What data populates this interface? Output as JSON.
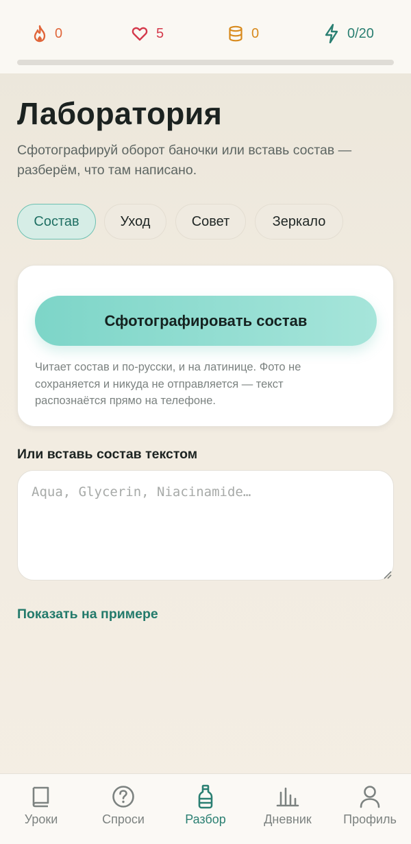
{
  "stats": {
    "streak": "0",
    "lives": "5",
    "coins": "0",
    "energy": "0/20",
    "progress_fraction": 0
  },
  "header": {
    "title": "Лаборатория",
    "subtitle": "Сфотографируй оборот баночки или вставь состав — разберём, что там написано."
  },
  "tabs": [
    {
      "label": "Состав",
      "active": true
    },
    {
      "label": "Уход",
      "active": false
    },
    {
      "label": "Совет",
      "active": false
    },
    {
      "label": "Зеркало",
      "active": false
    }
  ],
  "scan_card": {
    "button_label": "Сфотографировать состав",
    "note": "Читает состав и по-русски, и на латинице. Фото не сохраняется и никуда не отправляется — текст распознаётся прямо на телефоне."
  },
  "paste": {
    "label": "Или вставь состав текстом",
    "value": "",
    "placeholder": "Aqua, Glycerin, Niacinamide…"
  },
  "example_link": "Показать на примере",
  "bottom_nav": [
    {
      "label": "Уроки",
      "icon": "book-icon",
      "active": false
    },
    {
      "label": "Спроси",
      "icon": "question-icon",
      "active": false
    },
    {
      "label": "Разбор",
      "icon": "bottle-icon",
      "active": true
    },
    {
      "label": "Дневник",
      "icon": "chart-icon",
      "active": false
    },
    {
      "label": "Профиль",
      "icon": "user-icon",
      "active": false
    }
  ],
  "colors": {
    "accent": "#2a7f72",
    "accent_light": "#7dd5c8",
    "streak": "#e0663a",
    "lives": "#d4394b",
    "coins": "#d88a1d",
    "background": "#f3ede2"
  }
}
